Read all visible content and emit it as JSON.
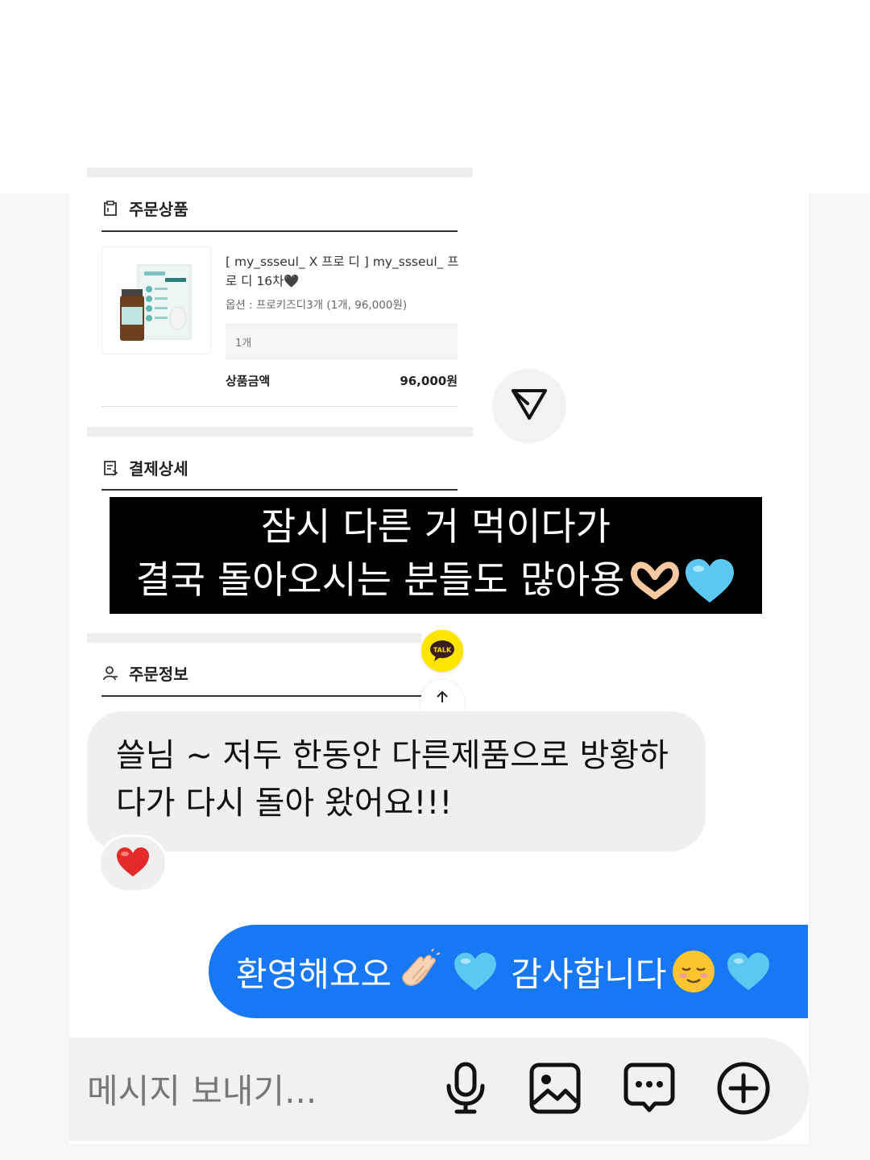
{
  "order_products": {
    "title": "주문상품",
    "product_name": "[ my_ssseul_ X 프로 디 ] my_ssseul_ 프로 디 16차🖤",
    "option": "옵션 : 프로키즈디3개 (1개, 96,000원)",
    "quantity": "1개",
    "price_label": "상품금액",
    "price_value": "96,000원"
  },
  "payment": {
    "title": "결제상세"
  },
  "order_info": {
    "title": "주문정보"
  },
  "caption": {
    "line1": "잠시 다른 거 먹이다가",
    "line2": "결국 돌아오시는 분들도 많아용"
  },
  "talk_button": {
    "label": "TALK"
  },
  "messages": {
    "incoming": "쓸님 ~ 저두 한동안 다른제품으로 방황하다가 다시 돌아 왔어요!!!",
    "outgoing_part1": "환영해요오",
    "outgoing_part2": "감사합니다"
  },
  "composer": {
    "placeholder": "메시지 보내기..."
  },
  "icons": {
    "order": "clipboard-icon",
    "payment": "receipt-icon",
    "order_info": "person-icon",
    "share": "send-icon",
    "scroll_top": "arrow-up-icon",
    "reaction": "red-heart-icon",
    "mic": "microphone-icon",
    "gallery": "image-icon",
    "sticker": "chat-bubble-icon",
    "more": "plus-circle-icon"
  },
  "colors": {
    "outgoing_bubble": "#1877f2",
    "incoming_bubble": "#efefef",
    "kakao_yellow": "#fee500"
  }
}
